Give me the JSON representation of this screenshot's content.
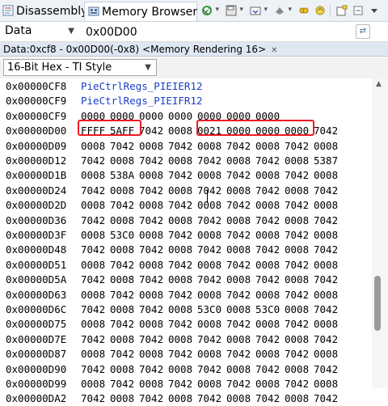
{
  "tabs": [
    {
      "label": "Disassembly",
      "icon": "disassembly-icon",
      "active": false
    },
    {
      "label": "Memory Browser",
      "icon": "memory-icon",
      "active": true,
      "close": "✕"
    }
  ],
  "toolbar": {
    "buttons": [
      "refresh-icon",
      "save-memory-icon",
      "load-memory-icon",
      "fill-memory-icon",
      "link-icon",
      "sync-icon",
      "new-window-icon",
      "pin-icon",
      "menu-icon"
    ]
  },
  "address_bar": {
    "space": "Data",
    "expression": "0x00D00"
  },
  "rendering_tab": {
    "label": "Data:0xcf8 - 0x00D00(-0x8) <Memory Rendering 16>",
    "close": "✕"
  },
  "format": {
    "selected": "16-Bit Hex - TI Style"
  },
  "colors": {
    "highlight": "#ee1b24",
    "register_link": "#1a3fc9"
  },
  "memory_rows": [
    {
      "addr": "0x00000CF8",
      "label": "PieCtrlRegs_PIEIER12"
    },
    {
      "addr": "0x00000CF9",
      "label": "PieCtrlRegs_PIEIFR12"
    },
    {
      "addr": "0x00000CF9",
      "words": [
        "0000",
        "0000",
        "0000",
        "0000",
        "0000",
        "0000",
        "0000"
      ]
    },
    {
      "addr": "0x00000D00",
      "words": [
        "FFFF",
        "5AFF",
        "7042",
        "0008",
        "0021",
        "0000",
        "0000",
        "0000",
        "7042"
      ]
    },
    {
      "addr": "0x00000D09",
      "words": [
        "0008",
        "7042",
        "0008",
        "7042",
        "0008",
        "7042",
        "0008",
        "7042",
        "0008"
      ]
    },
    {
      "addr": "0x00000D12",
      "words": [
        "7042",
        "0008",
        "7042",
        "0008",
        "7042",
        "0008",
        "7042",
        "0008",
        "5387"
      ]
    },
    {
      "addr": "0x00000D1B",
      "words": [
        "0008",
        "538A",
        "0008",
        "7042",
        "0008",
        "7042",
        "0008",
        "7042",
        "0008"
      ]
    },
    {
      "addr": "0x00000D24",
      "words": [
        "7042",
        "0008",
        "7042",
        "0008",
        "7042",
        "0008",
        "7042",
        "0008",
        "7042"
      ]
    },
    {
      "addr": "0x00000D2D",
      "words": [
        "0008",
        "7042",
        "0008",
        "7042",
        "0008",
        "7042",
        "0008",
        "7042",
        "0008"
      ]
    },
    {
      "addr": "0x00000D36",
      "words": [
        "7042",
        "0008",
        "7042",
        "0008",
        "7042",
        "0008",
        "7042",
        "0008",
        "7042"
      ]
    },
    {
      "addr": "0x00000D3F",
      "words": [
        "0008",
        "53C0",
        "0008",
        "7042",
        "0008",
        "7042",
        "0008",
        "7042",
        "0008"
      ]
    },
    {
      "addr": "0x00000D48",
      "words": [
        "7042",
        "0008",
        "7042",
        "0008",
        "7042",
        "0008",
        "7042",
        "0008",
        "7042"
      ]
    },
    {
      "addr": "0x00000D51",
      "words": [
        "0008",
        "7042",
        "0008",
        "7042",
        "0008",
        "7042",
        "0008",
        "7042",
        "0008"
      ]
    },
    {
      "addr": "0x00000D5A",
      "words": [
        "7042",
        "0008",
        "7042",
        "0008",
        "7042",
        "0008",
        "7042",
        "0008",
        "7042"
      ]
    },
    {
      "addr": "0x00000D63",
      "words": [
        "0008",
        "7042",
        "0008",
        "7042",
        "0008",
        "7042",
        "0008",
        "7042",
        "0008"
      ]
    },
    {
      "addr": "0x00000D6C",
      "words": [
        "7042",
        "0008",
        "7042",
        "0008",
        "53C0",
        "0008",
        "53C0",
        "0008",
        "7042"
      ]
    },
    {
      "addr": "0x00000D75",
      "words": [
        "0008",
        "7042",
        "0008",
        "7042",
        "0008",
        "7042",
        "0008",
        "7042",
        "0008"
      ]
    },
    {
      "addr": "0x00000D7E",
      "words": [
        "7042",
        "0008",
        "7042",
        "0008",
        "7042",
        "0008",
        "7042",
        "0008",
        "7042"
      ]
    },
    {
      "addr": "0x00000D87",
      "words": [
        "0008",
        "7042",
        "0008",
        "7042",
        "0008",
        "7042",
        "0008",
        "7042",
        "0008"
      ]
    },
    {
      "addr": "0x00000D90",
      "words": [
        "7042",
        "0008",
        "7042",
        "0008",
        "7042",
        "0008",
        "7042",
        "0008",
        "7042"
      ]
    },
    {
      "addr": "0x00000D99",
      "words": [
        "0008",
        "7042",
        "0008",
        "7042",
        "0008",
        "7042",
        "0008",
        "7042",
        "0008"
      ]
    },
    {
      "addr": "0x00000DA2",
      "words": [
        "7042",
        "0008",
        "7042",
        "0008",
        "7042",
        "0008",
        "7042",
        "0008",
        "7042"
      ]
    }
  ]
}
